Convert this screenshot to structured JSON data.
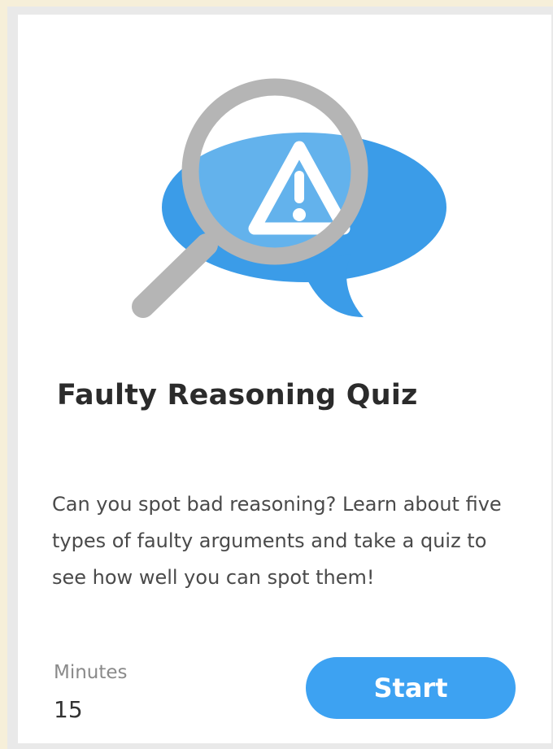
{
  "card": {
    "title": "Faulty Reasoning Quiz",
    "description": "Can you spot bad reasoning? Learn about five types of faulty arguments and take a quiz to see how well you can spot them!",
    "minutes_label": "Minutes",
    "minutes_value": "15",
    "start_label": "Start",
    "illustration_icons": [
      "speech-bubble-icon",
      "magnifying-glass-icon",
      "warning-icon"
    ]
  },
  "colors": {
    "page_background": "#f6efd9",
    "card_background": "#ffffff",
    "accent_blue": "#3da2f2",
    "bubble_blue": "#3b9ce8",
    "magnifier_gray": "#b5b5b5",
    "title_text": "#2b2b2b",
    "body_text": "#4a4a4a",
    "muted_text": "#8a8a8a"
  }
}
